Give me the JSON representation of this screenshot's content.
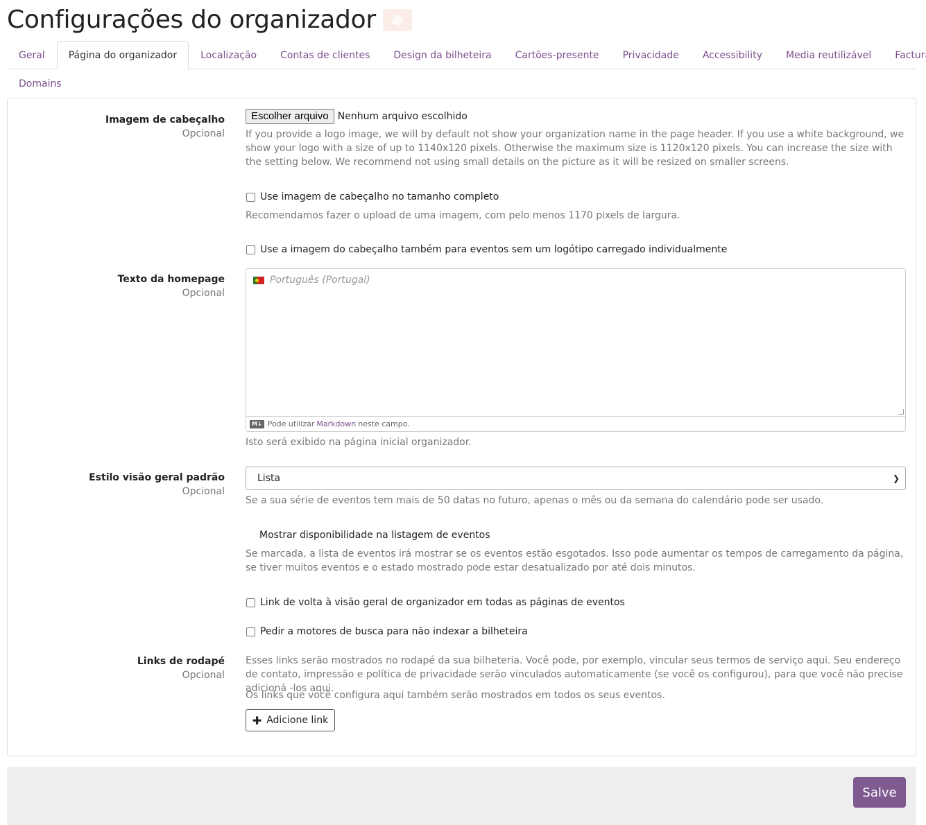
{
  "page": {
    "title": "Configurações do organizador"
  },
  "tabs": [
    {
      "label": "Geral"
    },
    {
      "label": "Página do organizador"
    },
    {
      "label": "Localização"
    },
    {
      "label": "Contas de clientes"
    },
    {
      "label": "Design da bilheteira"
    },
    {
      "label": "Cartões-presente"
    },
    {
      "label": "Privacidade"
    },
    {
      "label": "Accessibility"
    },
    {
      "label": "Media reutilizável"
    },
    {
      "label": "Facturas"
    },
    {
      "label": "Domains"
    }
  ],
  "active_tab": "Página do organizador",
  "header_image": {
    "label": "Imagem de cabeçalho",
    "optional": "Opcional",
    "button": "Escolher arquivo",
    "status": "Nenhum arquivo escolhido",
    "help": "If you provide a logo image, we will by default not show your organization name in the page header. If you use a white background, we show your logo with a size of up to 1140x120 pixels. Otherwise the maximum size is 1120x120 pixels. You can increase the size with the setting below. We recommend not using small details on the picture as it will be resized on smaller screens."
  },
  "full_size": {
    "label": "Use imagem de cabeçalho no tamanho completo",
    "help": "Recomendamos fazer o upload de uma imagem, com pelo menos 1170 pixels de largura.",
    "checked": false
  },
  "use_for_events": {
    "label": "Use a imagem do cabeçalho também para eventos sem um logótipo carregado individualmente",
    "checked": false
  },
  "homepage_text": {
    "label": "Texto da homepage",
    "optional": "Opcional",
    "placeholder": "Português (Portugal)",
    "markdown_prefix": "Pode utilizar",
    "markdown_link": "Markdown",
    "markdown_suffix": "neste campo.",
    "help": "Isto será exibido na página inicial organizador."
  },
  "overview_style": {
    "label": "Estilo visão geral padrão",
    "optional": "Opcional",
    "value": "Lista",
    "help": "Se a sua série de eventos tem mais de 50 datas no futuro, apenas o mês ou da semana do calendário pode ser usado."
  },
  "availability": {
    "label": "Mostrar disponibilidade na listagem de eventos",
    "help": "Se marcada, a lista de eventos irá mostrar se os eventos estão esgotados. Isso pode aumentar os tempos de carregamento da página, se tiver muitos eventos e o estado mostrado pode estar desatualizado por até dois minutos."
  },
  "back_link": {
    "label": "Link de volta à visão geral de organizador em todas as páginas de eventos",
    "checked": false
  },
  "noindex": {
    "label": "Pedir a motores de busca para não indexar a bilheteira",
    "checked": false
  },
  "footer_links": {
    "label": "Links de rodapé",
    "optional": "Opcional",
    "help1": "Esses links serão mostrados no rodapé da sua bilheteria. Você pode, por exemplo, vincular seus termos de serviço aqui. Seu endereço de contato, impressão e política de privacidade serão vinculados automaticamente (se você os configurou), para que você não precise adicioná -los aqui.",
    "help2": "Os links que você configura aqui também serão mostrados em todos os seus eventos.",
    "add_button": "Adicione link"
  },
  "save_button": "Salve",
  "colors": {
    "accent": "#7f5a91",
    "link": "#7c4e8c"
  }
}
